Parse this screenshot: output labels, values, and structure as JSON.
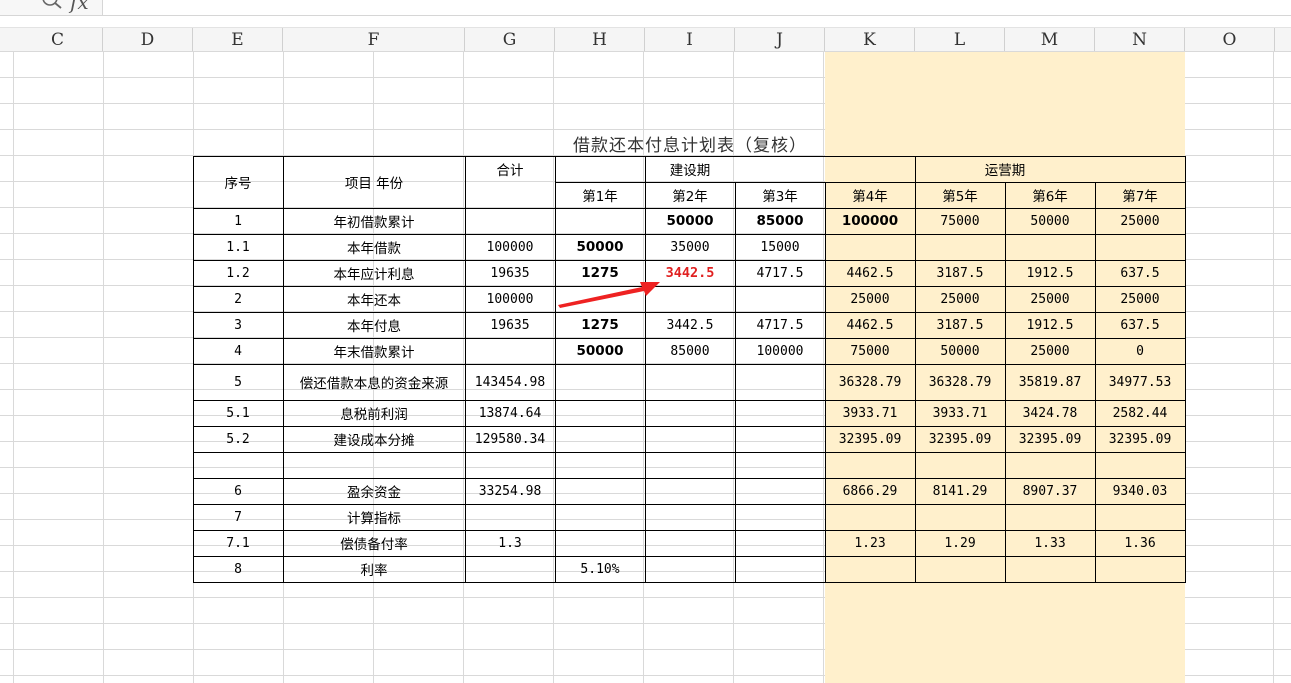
{
  "formula_bar": {
    "fx": "fx",
    "value": ""
  },
  "columns": [
    "C",
    "D",
    "E",
    "F",
    "G",
    "H",
    "I",
    "J",
    "K",
    "L",
    "M",
    "N",
    "O"
  ],
  "title": "借款还本付息计划表（复核）",
  "header": {
    "seq": "序号",
    "item_year": "项目        年份",
    "total": "合计",
    "construction": "建设期",
    "operation": "运营期",
    "years": [
      "第1年",
      "第2年",
      "第3年",
      "第4年",
      "第5年",
      "第6年",
      "第7年"
    ]
  },
  "rows": [
    {
      "seq": "1",
      "item": "年初借款累计",
      "total": "",
      "v": [
        "",
        "50000",
        "85000",
        "100000",
        "75000",
        "50000",
        "25000"
      ]
    },
    {
      "seq": "1.1",
      "item": "本年借款",
      "total": "100000",
      "v": [
        "50000",
        "35000",
        "15000",
        "",
        "",
        "",
        ""
      ]
    },
    {
      "seq": "1.2",
      "item": "本年应计利息",
      "total": "19635",
      "v": [
        "1275",
        "3442.5",
        "4717.5",
        "4462.5",
        "3187.5",
        "1912.5",
        "637.5"
      ]
    },
    {
      "seq": "2",
      "item": "本年还本",
      "total": "100000",
      "v": [
        "",
        "",
        "",
        "25000",
        "25000",
        "25000",
        "25000"
      ]
    },
    {
      "seq": "3",
      "item": "本年付息",
      "total": "19635",
      "v": [
        "1275",
        "3442.5",
        "4717.5",
        "4462.5",
        "3187.5",
        "1912.5",
        "637.5"
      ]
    },
    {
      "seq": "4",
      "item": "年末借款累计",
      "total": "",
      "v": [
        "50000",
        "85000",
        "100000",
        "75000",
        "50000",
        "25000",
        "0"
      ]
    },
    {
      "seq": "5",
      "item": "偿还借款本息的资金来源",
      "total": "143454.98",
      "v": [
        "",
        "",
        "",
        "36328.79",
        "36328.79",
        "35819.87",
        "34977.53"
      ]
    },
    {
      "seq": "5.1",
      "item": "息税前利润",
      "total": "13874.64",
      "v": [
        "",
        "",
        "",
        "3933.71",
        "3933.71",
        "3424.78",
        "2582.44"
      ]
    },
    {
      "seq": "5.2",
      "item": "建设成本分摊",
      "total": "129580.34",
      "v": [
        "",
        "",
        "",
        "32395.09",
        "32395.09",
        "32395.09",
        "32395.09"
      ]
    },
    {
      "seq": "",
      "item": "",
      "total": "",
      "v": [
        "",
        "",
        "",
        "",
        "",
        "",
        ""
      ]
    },
    {
      "seq": "6",
      "item": "盈余资金",
      "total": "33254.98",
      "v": [
        "",
        "",
        "",
        "6866.29",
        "8141.29",
        "8907.37",
        "9340.03"
      ]
    },
    {
      "seq": "7",
      "item": "计算指标",
      "total": "",
      "v": [
        "",
        "",
        "",
        "",
        "",
        "",
        ""
      ]
    },
    {
      "seq": "7.1",
      "item": "偿债备付率",
      "total": "1.3",
      "v": [
        "",
        "",
        "",
        "1.23",
        "1.29",
        "1.33",
        "1.36"
      ]
    },
    {
      "seq": "8",
      "item": "利率",
      "total": "",
      "v": [
        "5.10%",
        "",
        "",
        "",
        "",
        "",
        ""
      ]
    }
  ],
  "colors": {
    "operation_fill": "#fff0cc",
    "highlight_red": "#e02020",
    "grid": "#d9d9d9"
  }
}
